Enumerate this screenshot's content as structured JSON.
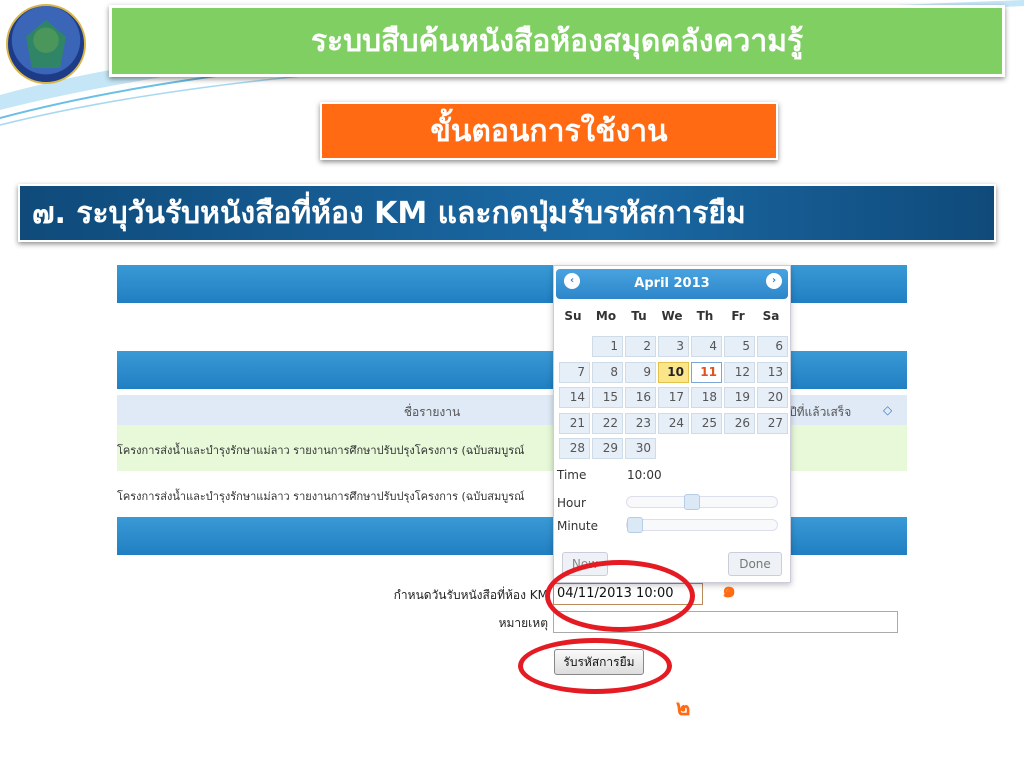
{
  "header": {
    "title": "ระบบสืบค้นหนังสือห้องสมุดคลังความรู้",
    "steps_title": "ขั้นตอนการใช้งาน",
    "step_text": "๗. ระบุวันรับหนังสือที่ห้อง KM และกดปุ่มรับรหัสการยืม"
  },
  "table": {
    "col_title": "ชื่อรายงาน",
    "col_year": "ปีที่แล้วเสร็จ",
    "rows": [
      {
        "title": "โครงการส่งน้ำและบำรุงรักษาแม่ลาว รายงานการศึกษาปรับปรุงโครงการ (ฉบับสมบูรณ์"
      },
      {
        "title": "โครงการส่งน้ำและบำรุงรักษาแม่ลาว รายงานการศึกษาปรับปรุงโครงการ (ฉบับสมบูรณ์"
      }
    ]
  },
  "form": {
    "date_label": "กำหนดวันรับหนังสือที่ห้อง KM",
    "date_value": "04/11/2013 10:00",
    "note_label": "หมายเหตุ",
    "submit_label": "รับรหัสการยืม"
  },
  "datepicker": {
    "month_year": "April 2013",
    "prev_icon": "‹",
    "next_icon": "›",
    "weekdays": [
      "Su",
      "Mo",
      "Tu",
      "We",
      "Th",
      "Fr",
      "Sa"
    ],
    "days": [
      "1",
      "2",
      "3",
      "4",
      "5",
      "6",
      "7",
      "8",
      "9",
      "10",
      "11",
      "12",
      "13",
      "14",
      "15",
      "16",
      "17",
      "18",
      "19",
      "20",
      "21",
      "22",
      "23",
      "24",
      "25",
      "26",
      "27",
      "28",
      "29",
      "30"
    ],
    "today": "10",
    "selected": "11",
    "time_label": "Time",
    "time_value": "10:00",
    "hour_label": "Hour",
    "minute_label": "Minute",
    "hour_level": 0.42,
    "minute_level": 0.0,
    "now_label": "Now",
    "done_label": "Done"
  },
  "annotations": {
    "marker_1": "๑",
    "marker_2": "๒",
    "ring_color": "#e41b23",
    "marker_color": "#ff6a13"
  }
}
